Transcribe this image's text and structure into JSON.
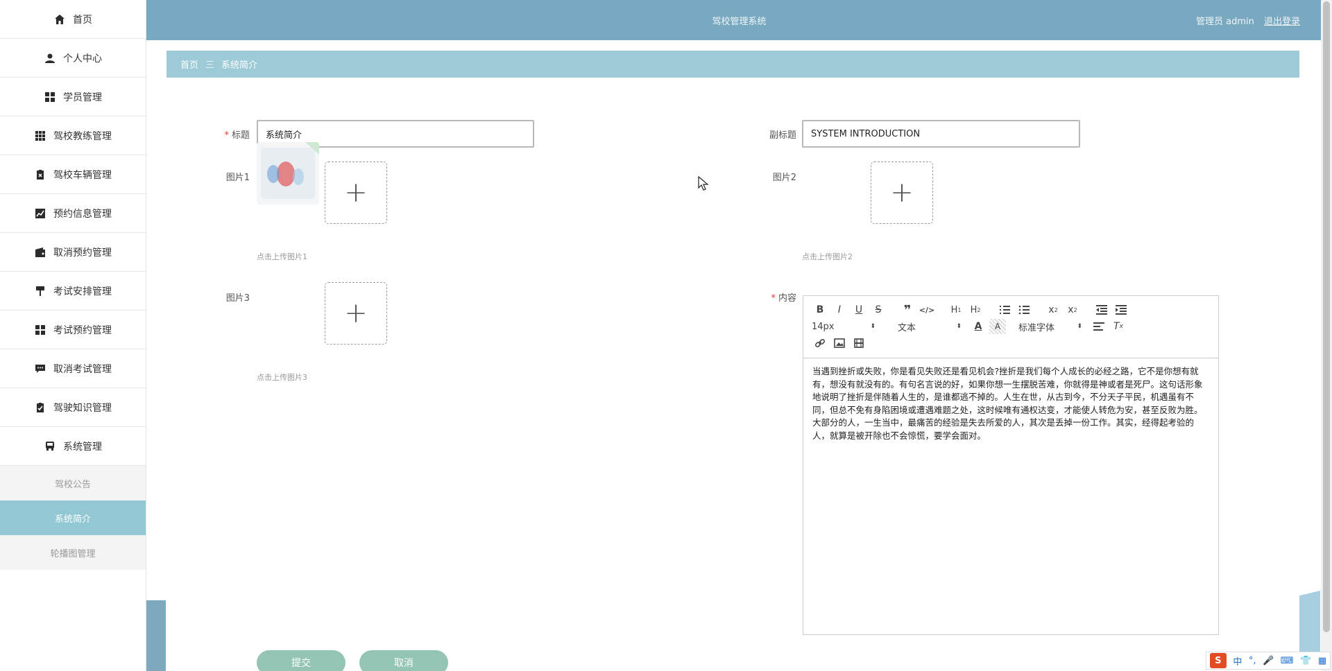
{
  "app": {
    "title": "驾校管理系统"
  },
  "user": {
    "label": "管理员 admin",
    "logout": "退出登录"
  },
  "sidebar": {
    "items": [
      {
        "label": "首页",
        "icon": "home-icon"
      },
      {
        "label": "个人中心",
        "icon": "user-icon"
      },
      {
        "label": "学员管理",
        "icon": "grid-icon"
      },
      {
        "label": "驾校教练管理",
        "icon": "apps-icon"
      },
      {
        "label": "驾校车辆管理",
        "icon": "clipboard-icon"
      },
      {
        "label": "预约信息管理",
        "icon": "chart-icon"
      },
      {
        "label": "取消预约管理",
        "icon": "wallet-icon"
      },
      {
        "label": "考试安排管理",
        "icon": "pin-icon"
      },
      {
        "label": "考试预约管理",
        "icon": "grid-icon"
      },
      {
        "label": "取消考试管理",
        "icon": "message-icon"
      },
      {
        "label": "驾驶知识管理",
        "icon": "clipboard-check-icon"
      },
      {
        "label": "系统管理",
        "icon": "bus-icon"
      }
    ],
    "subitems": [
      {
        "label": "驾校公告",
        "active": false
      },
      {
        "label": "系统简介",
        "active": true
      },
      {
        "label": "轮播图管理",
        "active": false
      }
    ]
  },
  "breadcrumb": {
    "home": "首页",
    "separator": "三",
    "current": "系统简介"
  },
  "form": {
    "title_label": "标题",
    "title_value": "系统简介",
    "subtitle_label": "副标题",
    "subtitle_value": "SYSTEM INTRODUCTION",
    "pic1_label": "图片1",
    "pic1_hint": "点击上传图片1",
    "pic2_label": "图片2",
    "pic2_hint": "点击上传图片2",
    "pic3_label": "图片3",
    "pic3_hint": "点击上传图片3",
    "content_label": "内容",
    "submit": "提交",
    "cancel": "取消"
  },
  "editor": {
    "font_size": "14px",
    "block_type": "文本",
    "font_family": "标准字体",
    "content": "当遇到挫折或失败，你是看见失败还是看见机会?挫折是我们每个人成长的必经之路，它不是你想有就有，想没有就没有的。有句名言说的好，如果你想一生摆脱苦难，你就得是神或者是死尸。这句话形象地说明了挫折是伴随着人生的，是谁都逃不掉的。人生在世，从古到今，不分天子平民，机遇虽有不同，但总不免有身陷困境或遭遇难题之处，这时候唯有通权达变，才能使人转危为安，甚至反败为胜。大部分的人，一生当中，最痛苦的经验是失去所爱的人，其次是丢掉一份工作。其实，经得起考验的人，就算是被开除也不会惊慌，要学会面对。"
  },
  "ime": {
    "mode": "中"
  }
}
